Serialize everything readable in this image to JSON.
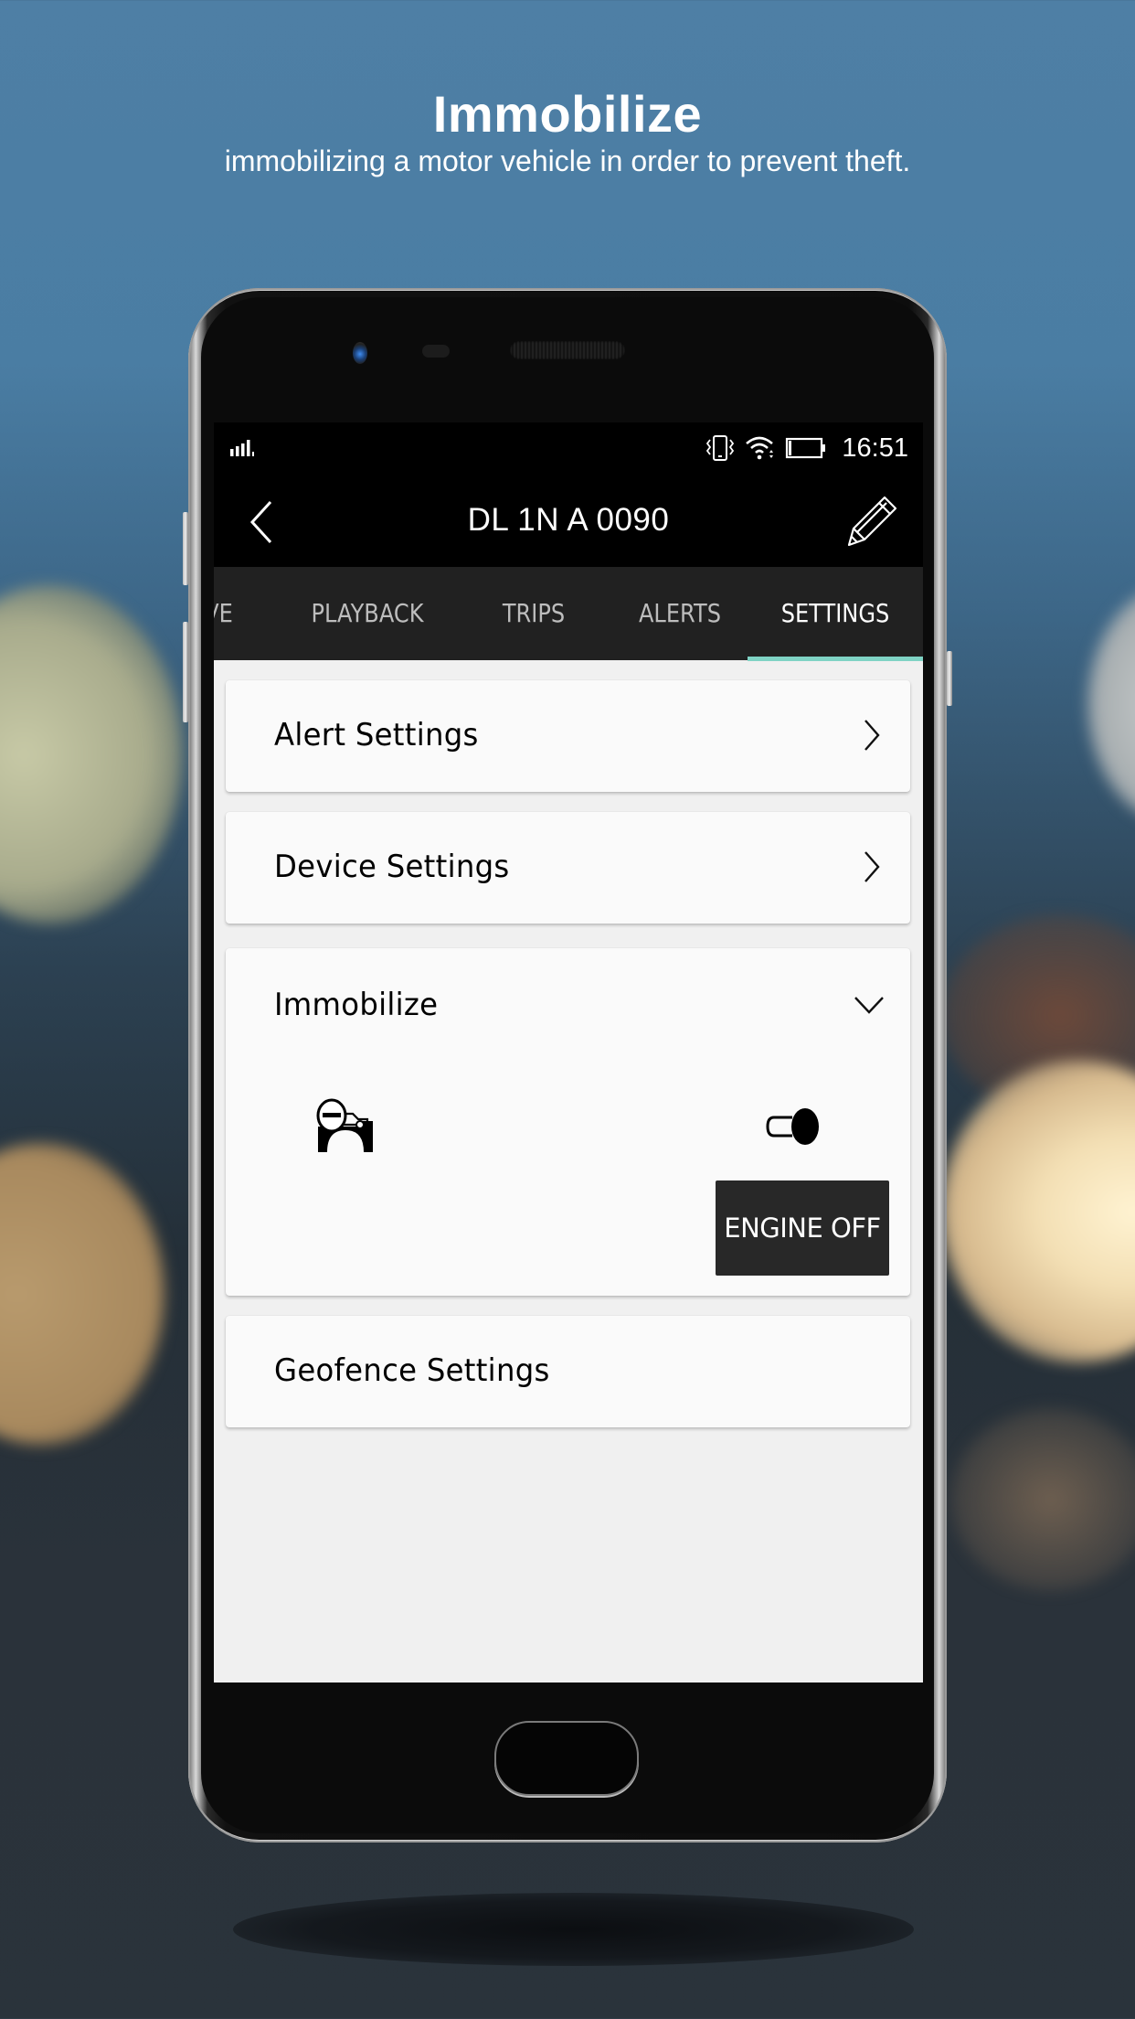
{
  "promo": {
    "title": "Immobilize",
    "subtitle": "immobilizing a motor vehicle in order to prevent theft."
  },
  "status_bar": {
    "time": "16:51",
    "icons": [
      "signal-icon",
      "vibrate-icon",
      "wifi-icon",
      "battery-icon"
    ]
  },
  "app_bar": {
    "title": "DL 1N A 0090",
    "back_icon": "chevron-left-icon",
    "edit_icon": "pencil-icon"
  },
  "tabs": [
    {
      "label": "VE",
      "active": false
    },
    {
      "label": "PLAYBACK",
      "active": false
    },
    {
      "label": "TRIPS",
      "active": false
    },
    {
      "label": "ALERTS",
      "active": false
    },
    {
      "label": "SETTINGS",
      "active": true
    }
  ],
  "settings": {
    "alert_settings": {
      "label": "Alert Settings",
      "icon": "chevron-right-icon"
    },
    "device_settings": {
      "label": "Device Settings",
      "icon": "chevron-right-icon"
    },
    "immobilize": {
      "label": "Immobilize",
      "icon": "chevron-down-icon",
      "expanded": true,
      "vehicle_icon": "immobilized-car-icon",
      "toggle_on": true,
      "engine_button": "ENGINE OFF"
    },
    "geofence_settings": {
      "label": "Geofence Settings"
    }
  },
  "colors": {
    "tab_indicator": "#7fd3c4",
    "tab_bar": "#212121",
    "engine_button": "#282828",
    "card": "#fafafa",
    "screen_bg": "#f0f0f0"
  }
}
